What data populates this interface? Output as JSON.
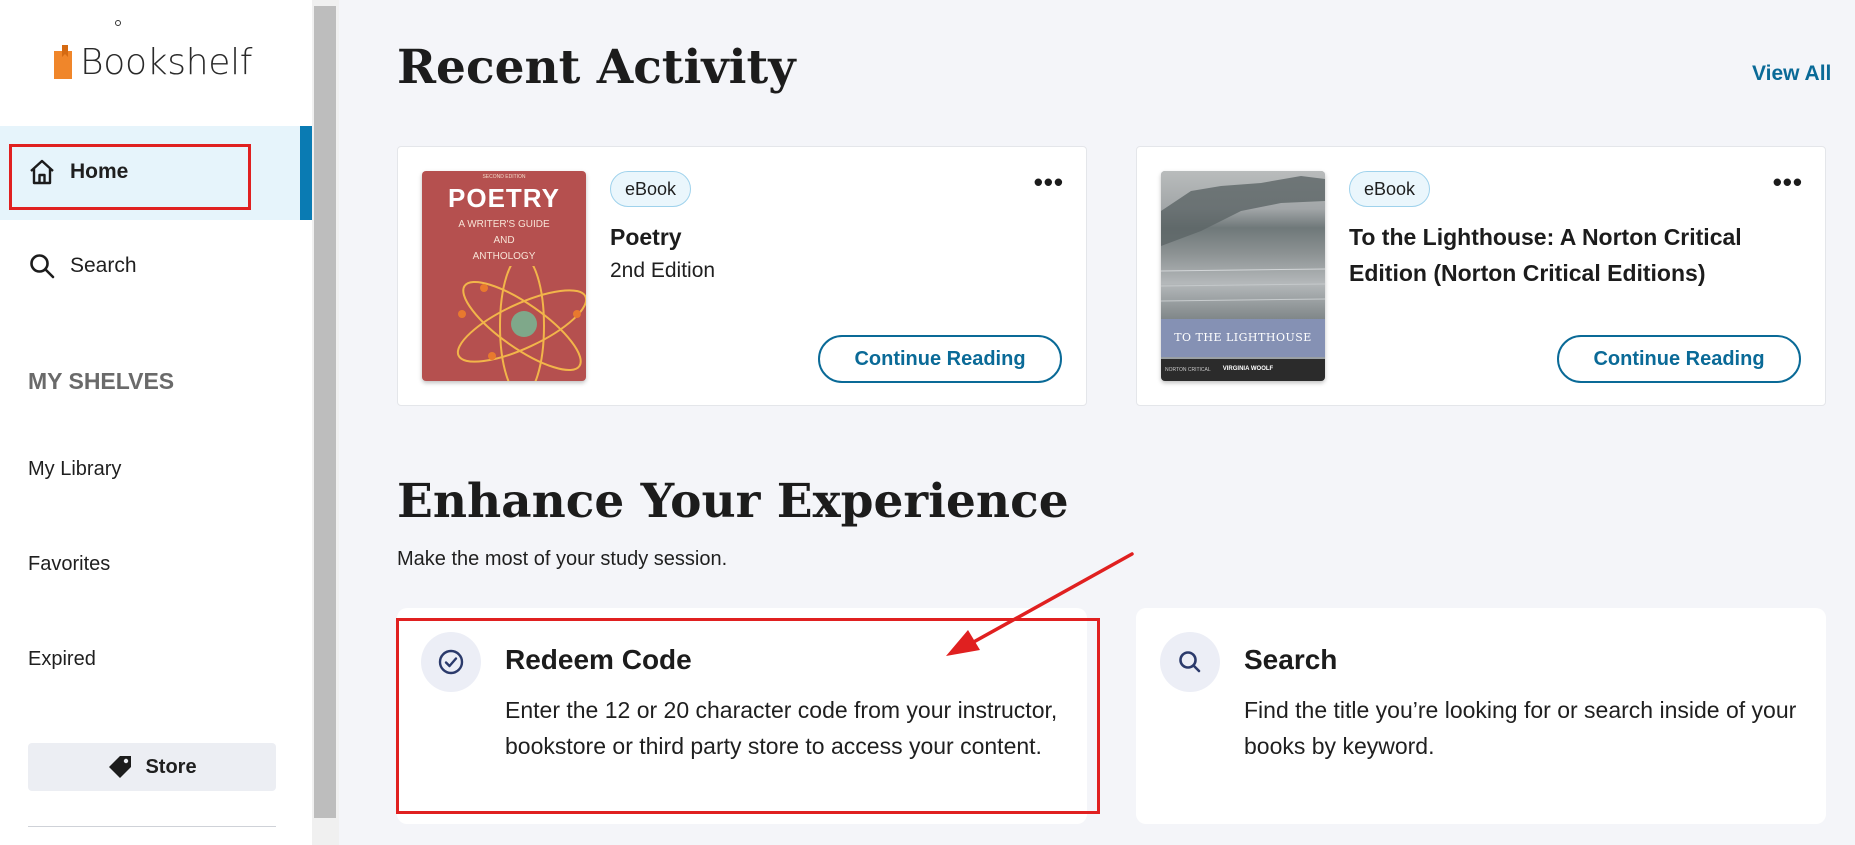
{
  "sidebar": {
    "logo_text": "Bookshelf",
    "nav": {
      "home_label": "Home",
      "search_label": "Search"
    },
    "shelves_title": "MY SHELVES",
    "shelves": [
      "My Library",
      "Favorites",
      "Expired"
    ],
    "store_label": "Store"
  },
  "recent": {
    "title": "Recent Activity",
    "view_all": "View All",
    "books": [
      {
        "badge": "eBook",
        "title": "Poetry",
        "edition": "2nd Edition",
        "button": "Continue Reading",
        "cover": {
          "edition_text": "SECOND EDITION",
          "title": "POETRY",
          "subtitle_lines": [
            "A WRITER'S GUIDE",
            "AND",
            "ANTHOLOGY"
          ]
        }
      },
      {
        "badge": "eBook",
        "title": "To the Lighthouse: A Norton Critical Edition (Norton Critical Editions)",
        "button": "Continue Reading",
        "cover": {
          "band_text": "TO THE LIGHTHOUSE",
          "publisher": "NORTON CRITICAL",
          "author": "VIRGINIA WOOLF"
        }
      }
    ]
  },
  "enhance": {
    "title": "Enhance Your Experience",
    "subtitle": "Make the most of your study session.",
    "cards": [
      {
        "icon": "check-circle-icon",
        "title": "Redeem Code",
        "description": "Enter the 12 or 20 character code from your instructor, bookstore or third party store to access your content."
      },
      {
        "icon": "search-icon",
        "title": "Search",
        "description": "Find the title you’re looking for or search inside of your books by keyword."
      }
    ]
  },
  "colors": {
    "accent": "#0a7bb3",
    "link": "#0a6a97",
    "annotation": "#e02020",
    "logo_orange": "#f0862a"
  }
}
